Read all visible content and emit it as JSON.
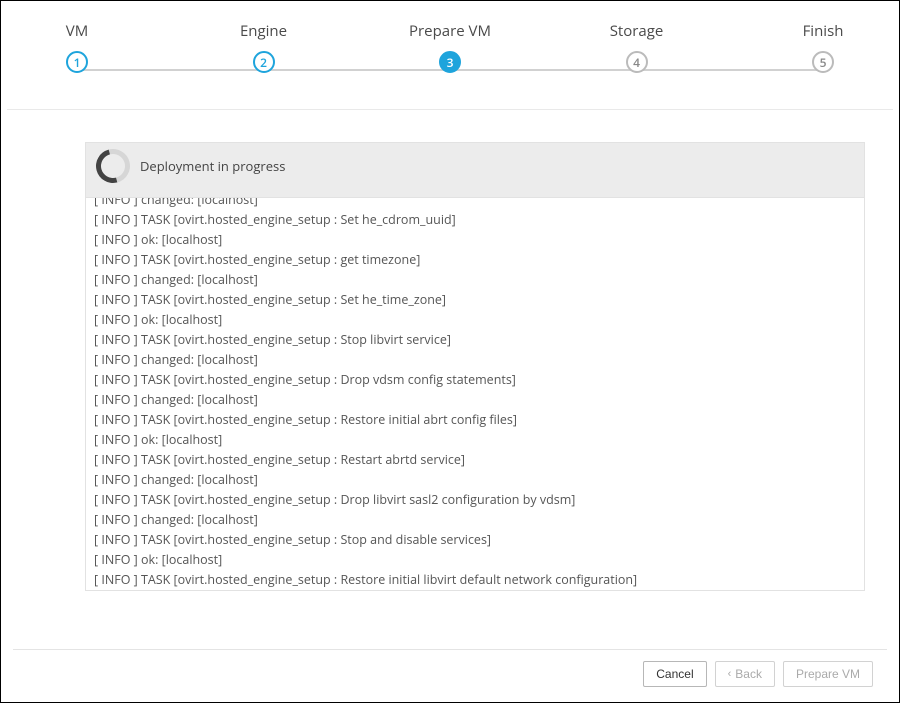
{
  "steps": [
    {
      "num": "1",
      "label": "VM",
      "state": "done"
    },
    {
      "num": "2",
      "label": "Engine",
      "state": "done"
    },
    {
      "num": "3",
      "label": "Prepare VM",
      "state": "active"
    },
    {
      "num": "4",
      "label": "Storage",
      "state": "upcoming"
    },
    {
      "num": "5",
      "label": "Finish",
      "state": "upcoming"
    }
  ],
  "status": {
    "text": "Deployment in progress"
  },
  "log": [
    "[ INFO ] changed: [localhost]",
    "[ INFO ] TASK [ovirt.hosted_engine_setup : Set he_cdrom_uuid]",
    "[ INFO ] ok: [localhost]",
    "[ INFO ] TASK [ovirt.hosted_engine_setup : get timezone]",
    "[ INFO ] changed: [localhost]",
    "[ INFO ] TASK [ovirt.hosted_engine_setup : Set he_time_zone]",
    "[ INFO ] ok: [localhost]",
    "[ INFO ] TASK [ovirt.hosted_engine_setup : Stop libvirt service]",
    "[ INFO ] changed: [localhost]",
    "[ INFO ] TASK [ovirt.hosted_engine_setup : Drop vdsm config statements]",
    "[ INFO ] changed: [localhost]",
    "[ INFO ] TASK [ovirt.hosted_engine_setup : Restore initial abrt config files]",
    "[ INFO ] ok: [localhost]",
    "[ INFO ] TASK [ovirt.hosted_engine_setup : Restart abrtd service]",
    "[ INFO ] changed: [localhost]",
    "[ INFO ] TASK [ovirt.hosted_engine_setup : Drop libvirt sasl2 configuration by vdsm]",
    "[ INFO ] changed: [localhost]",
    "[ INFO ] TASK [ovirt.hosted_engine_setup : Stop and disable services]",
    "[ INFO ] ok: [localhost]",
    "[ INFO ] TASK [ovirt.hosted_engine_setup : Restore initial libvirt default network configuration]"
  ],
  "footer": {
    "cancel": "Cancel",
    "back": "Back",
    "next": "Prepare VM"
  }
}
